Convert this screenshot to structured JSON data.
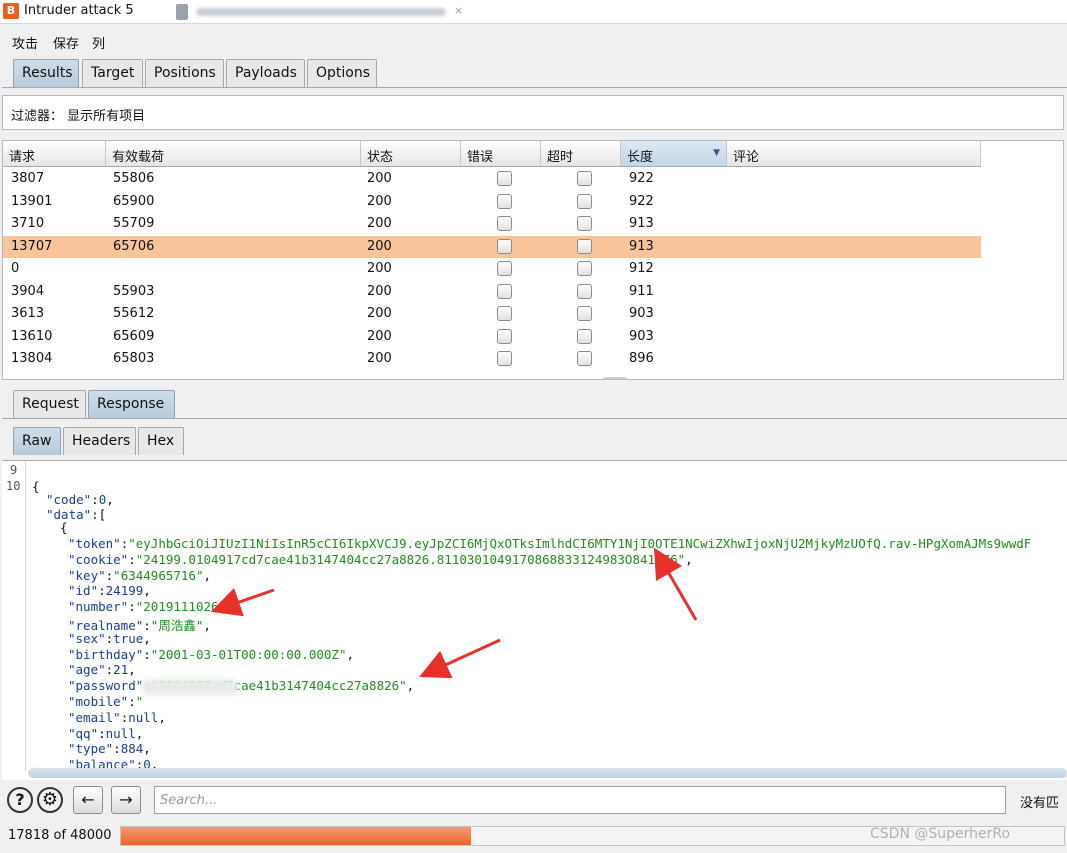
{
  "window": {
    "title": "Intruder attack 5",
    "logo_letter": "B",
    "close_glyph": "×"
  },
  "menu": [
    "攻击",
    "保存",
    "列"
  ],
  "tabs": [
    "Results",
    "Target",
    "Positions",
    "Payloads",
    "Options"
  ],
  "filter": {
    "label": "过滤器： 显示所有项目"
  },
  "table": {
    "headers": [
      "请求",
      "有效载荷",
      "状态",
      "错误",
      "超时",
      "长度",
      "评论"
    ],
    "sorted_column": "长度",
    "sort_glyph": "▼",
    "rows": [
      {
        "request": "3807",
        "payload": "55806",
        "status": "200",
        "length": "922",
        "selected": false
      },
      {
        "request": "13901",
        "payload": "65900",
        "status": "200",
        "length": "922",
        "selected": false
      },
      {
        "request": "3710",
        "payload": "55709",
        "status": "200",
        "length": "913",
        "selected": false
      },
      {
        "request": "13707",
        "payload": "65706",
        "status": "200",
        "length": "913",
        "selected": true
      },
      {
        "request": "0",
        "payload": "",
        "status": "200",
        "length": "912",
        "selected": false
      },
      {
        "request": "3904",
        "payload": "55903",
        "status": "200",
        "length": "911",
        "selected": false
      },
      {
        "request": "3613",
        "payload": "55612",
        "status": "200",
        "length": "903",
        "selected": false
      },
      {
        "request": "13610",
        "payload": "65609",
        "status": "200",
        "length": "903",
        "selected": false
      },
      {
        "request": "13804",
        "payload": "65803",
        "status": "200",
        "length": "896",
        "selected": false
      }
    ]
  },
  "req_resp_tabs": [
    "Request",
    "Response"
  ],
  "view_tabs": [
    "Raw",
    "Headers",
    "Hex"
  ],
  "response": {
    "line_numbers": [
      "9",
      "10"
    ],
    "open_brace": "{",
    "code_key": "\"code\"",
    "code_value": "0",
    "data_key": "\"data\"",
    "data_open": ":[",
    "obj_open": "{",
    "fields": [
      {
        "key": "\"token\"",
        "value": "\"eyJhbGciOiJIUzI1NiIsInR5cCI6IkpXVCJ9.eyJpZCI6MjQxOTksImlhdCI6MTY1NjI0OTE1NCwiZXhwIjoxNjU2MjkyMzUOfQ.rav-HPgXomAJMs9wwdF",
        "type": "str",
        "trail": ""
      },
      {
        "key": "\"cookie\"",
        "value": "\"24199.0104917cd7cae41b3147404cc27a8826.8110301049170868833124983O841476\"",
        "type": "str",
        "trail": ","
      },
      {
        "key": "\"key\"",
        "value": "\"6344965716\"",
        "type": "str",
        "trail": ","
      },
      {
        "key": "\"id\"",
        "value": "24199",
        "type": "num",
        "trail": ","
      },
      {
        "key": "\"number\"",
        "value": "\"2019111026\"",
        "type": "str",
        "trail": ","
      },
      {
        "key": "\"realname\"",
        "value": "\"周浩鑫\"",
        "type": "str",
        "trail": ","
      },
      {
        "key": "\"sex\"",
        "value": "true",
        "type": "num",
        "trail": ","
      },
      {
        "key": "\"birthday\"",
        "value": "\"2001-03-01T00:00:00.000Z\"",
        "type": "str",
        "trail": ","
      },
      {
        "key": "\"age\"",
        "value": "21",
        "type": "num",
        "trail": ","
      },
      {
        "key": "\"password\"",
        "value": "\"0104917cd7cae41b3147404cc27a8826\"",
        "type": "str",
        "trail": ","
      },
      {
        "key": "\"mobile\"",
        "value": "\"",
        "type": "str",
        "trail": ""
      },
      {
        "key": "\"email\"",
        "value": "null",
        "type": "num",
        "trail": ","
      },
      {
        "key": "\"qq\"",
        "value": "null",
        "type": "num",
        "trail": ","
      },
      {
        "key": "\"type\"",
        "value": "884",
        "type": "num",
        "trail": ","
      },
      {
        "key": "\"balance\"",
        "value": "0",
        "type": "num",
        "trail": ","
      }
    ]
  },
  "toolbar": {
    "help_glyph": "?",
    "settings_glyph": "⚙",
    "back_glyph": "←",
    "forward_glyph": "→",
    "search_placeholder": "Search...",
    "no_match_text": "没有匹"
  },
  "status": {
    "progress_text": "17818 of 48000",
    "progress_fraction": 0.371,
    "watermark": "CSDN @SuperherRo"
  },
  "colors": {
    "selected_row": "#f9c49a",
    "progress_fill": "#e8642c",
    "annotation_arrow": "#e8312a",
    "json_string": "#1c8f1c",
    "json_key": "#1a3c9c"
  },
  "icons": [
    "app-logo-icon",
    "help-icon",
    "settings-gear-icon",
    "back-arrow-icon",
    "forward-arrow-icon",
    "sort-descending-icon",
    "checkbox-icon",
    "red-annotation-arrow-icon"
  ]
}
